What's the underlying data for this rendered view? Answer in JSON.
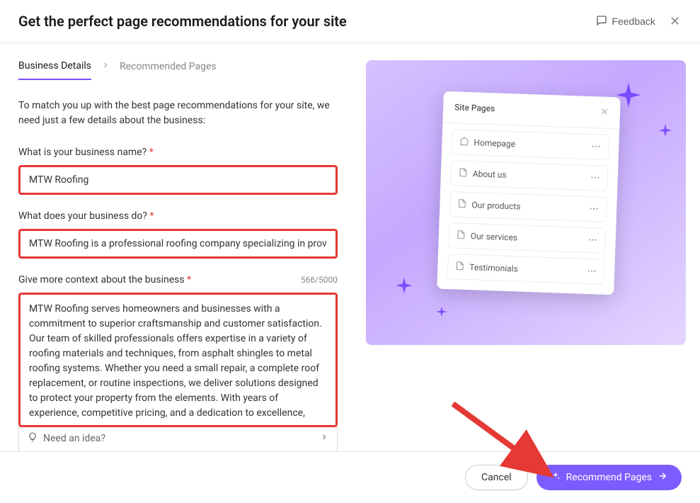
{
  "header": {
    "title": "Get the perfect page recommendations for your site",
    "feedback": "Feedback"
  },
  "breadcrumb": {
    "current": "Business Details",
    "next": "Recommended Pages"
  },
  "intro": "To match you up with the best page recommendations for your site, we need just a few details about the business:",
  "form": {
    "name": {
      "label": "What is your business name?",
      "value": "MTW Roofing"
    },
    "description": {
      "label": "What does your business do?",
      "value": "MTW Roofing is a professional roofing company specializing in providing"
    },
    "context": {
      "label": "Give more context about the business",
      "counter": "566/5000",
      "value": "MTW Roofing serves homeowners and businesses with a commitment to superior craftsmanship and customer satisfaction. Our team of skilled professionals offers expertise in a variety of roofing materials and techniques, from asphalt shingles to metal roofing systems. Whether you need a small repair, a complete roof replacement, or routine inspections, we deliver solutions designed to protect your property from the elements. With years of experience, competitive pricing, and a dedication to excellence, MTW Roofing has become a trusted name in the roofing industry."
    },
    "need_idea": "Need an idea?"
  },
  "illustration": {
    "card_title": "Site Pages",
    "items": [
      "Homepage",
      "About us",
      "Our products",
      "Our services",
      "Testimonials"
    ]
  },
  "footer": {
    "cancel": "Cancel",
    "recommend": "Recommend Pages"
  }
}
